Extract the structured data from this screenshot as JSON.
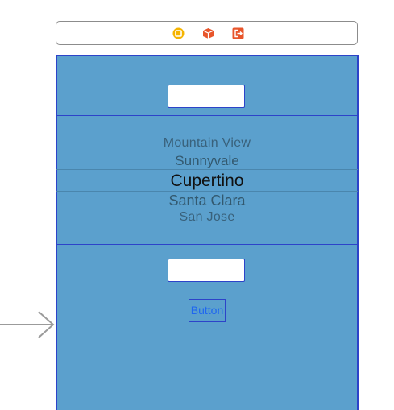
{
  "scene_dock": {
    "icons": [
      "view-controller-icon",
      "first-responder-icon",
      "exit-icon"
    ],
    "colors": {
      "view_controller": "#f5b400",
      "first_responder": "#e8552b",
      "exit": "#e8552b"
    }
  },
  "view": {
    "background": "#5ba0cd",
    "border": "#2d43c9",
    "top_text_field": {
      "value": ""
    },
    "picker": {
      "rows": [
        "Mountain View",
        "Sunnyvale",
        "Cupertino",
        "Santa Clara",
        "San Jose"
      ],
      "selected_index": 2
    },
    "bottom_text_field": {
      "value": ""
    },
    "button": {
      "label": "Button",
      "color": "#1f66f0"
    }
  },
  "entry_arrow": {
    "color": "#9b9b9b"
  }
}
